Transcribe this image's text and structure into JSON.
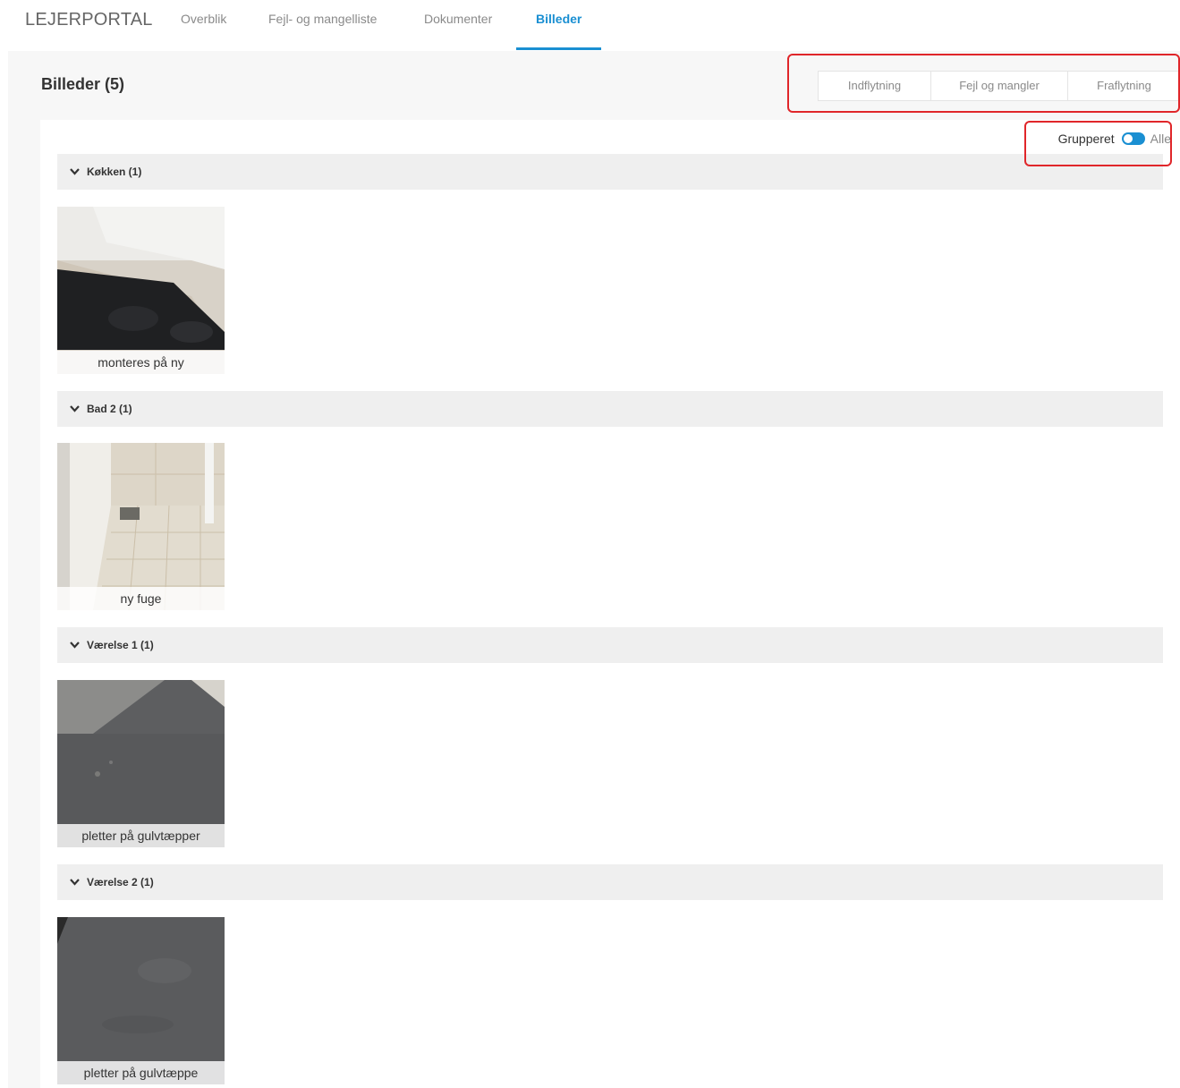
{
  "header": {
    "brand": "LEJERPORTAL",
    "nav": [
      {
        "label": "Overblik"
      },
      {
        "label": "Fejl- og mangelliste"
      },
      {
        "label": "Dokumenter"
      },
      {
        "label": "Billeder",
        "active": true
      }
    ]
  },
  "page": {
    "title": "Billeder (5)",
    "filters": [
      "Indflytning",
      "Fejl og mangler",
      "Fraflytning"
    ],
    "toggle": {
      "label": "Grupperet",
      "alt_label": "Alle",
      "on": true
    }
  },
  "groups": [
    {
      "title": "Køkken (1)",
      "images": [
        {
          "caption": "monteres på ny",
          "icon": "photo-stove"
        }
      ]
    },
    {
      "title": "Bad 2 (1)",
      "images": [
        {
          "caption": "ny fuge",
          "icon": "photo-bathroom"
        }
      ]
    },
    {
      "title": "Værelse 1 (1)",
      "images": [
        {
          "caption": "pletter på gulvtæpper",
          "icon": "photo-carpet"
        }
      ]
    },
    {
      "title": "Værelse 2 (1)",
      "images": [
        {
          "caption": "pletter på gulvtæppe",
          "icon": "photo-carpet"
        }
      ]
    }
  ],
  "colors": {
    "accent": "#1a8fd2",
    "highlight": "#e0262a"
  }
}
